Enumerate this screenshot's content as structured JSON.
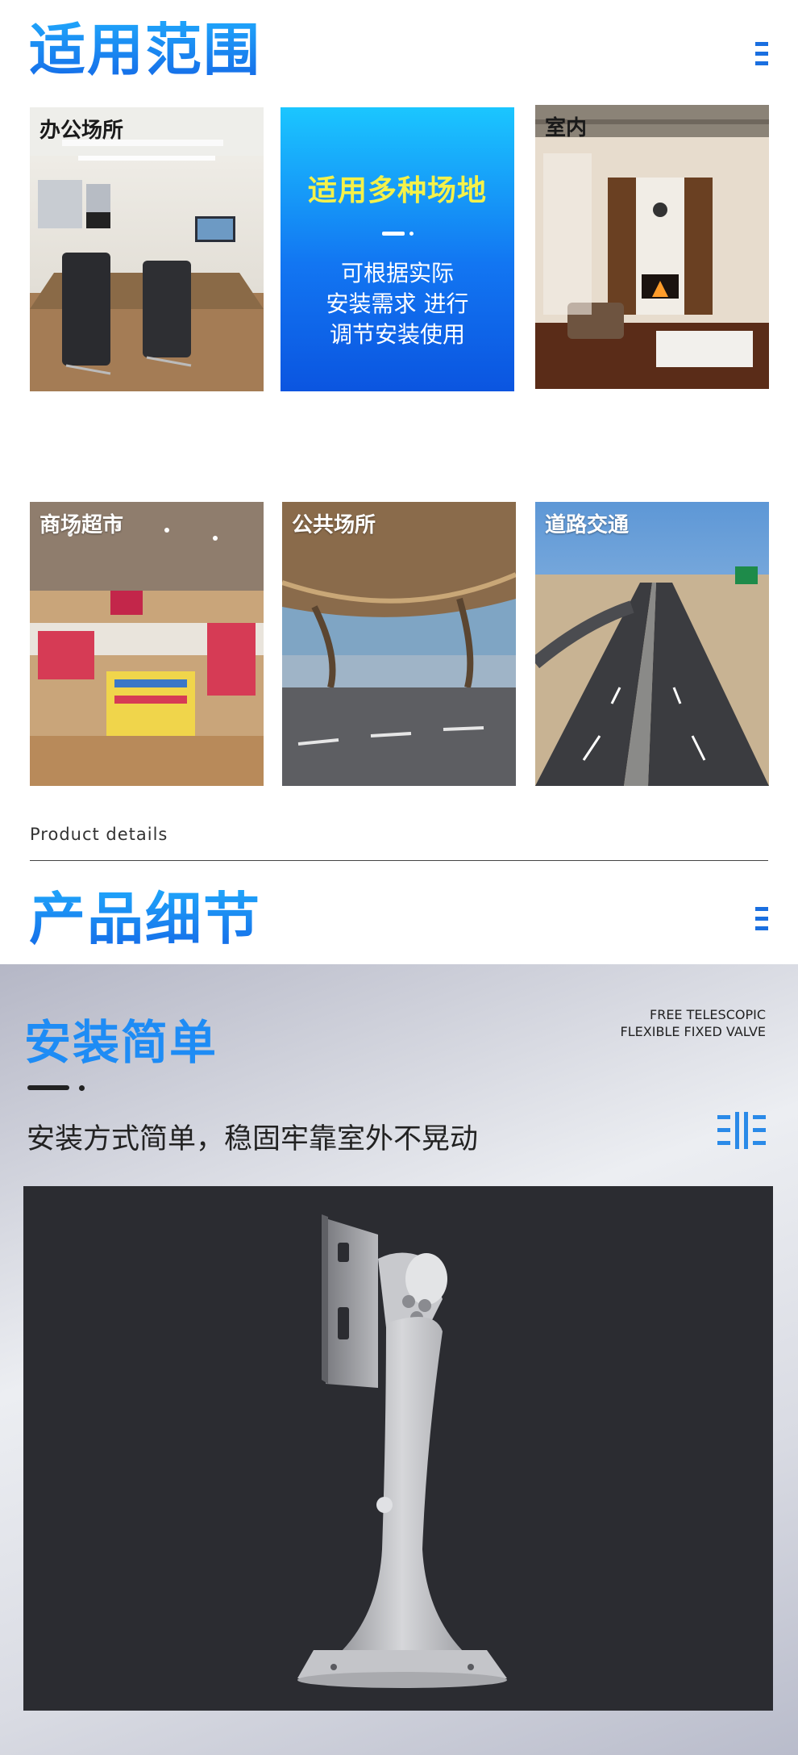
{
  "scope": {
    "title": "适用范围",
    "center": {
      "headline": "适用多种场地",
      "desc": "可根据实际\n安装需求 进行\n调节安装使用"
    },
    "cards": [
      "办公场所",
      "室内",
      "商场超市",
      "公共场所",
      "道路交通"
    ]
  },
  "details": {
    "label": "Product details",
    "title": "产品细节"
  },
  "install": {
    "title": "安装简单",
    "tagline_1": "FREE TELESCOPIC",
    "tagline_2": "FLEXIBLE FIXED VALVE",
    "subtitle": "安装方式简单，稳固牢靠室外不晃动"
  }
}
